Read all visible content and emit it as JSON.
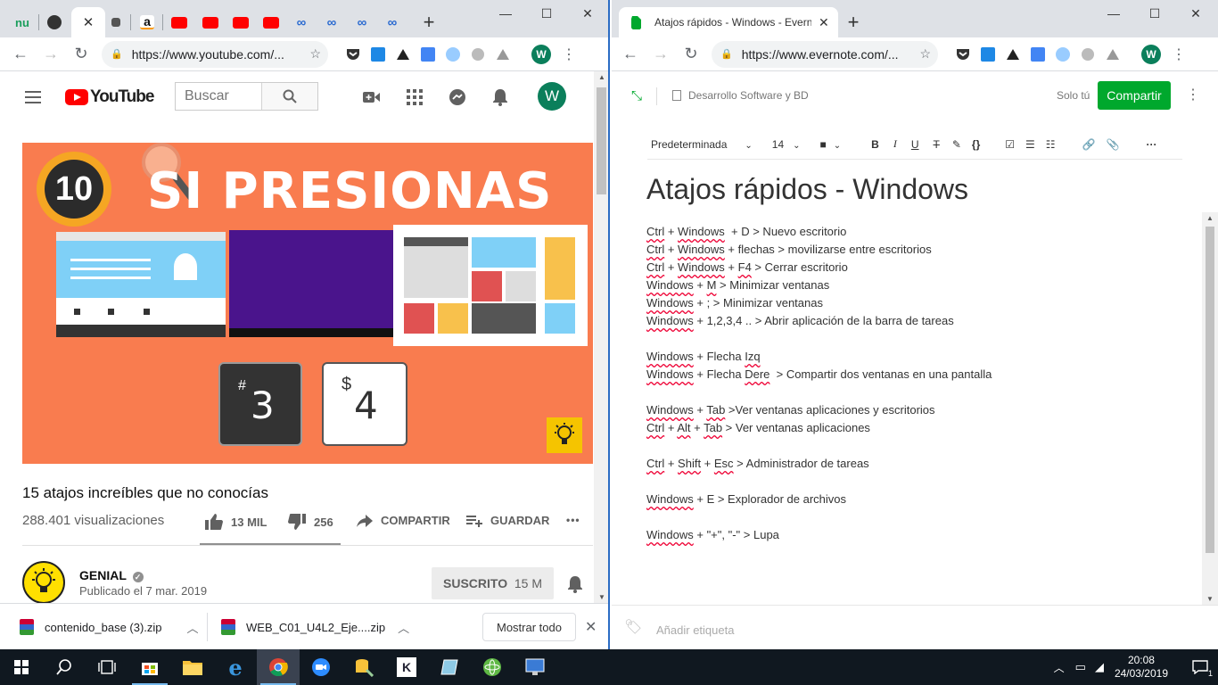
{
  "left_window": {
    "tabs": [
      {
        "icon": "nu-icon",
        "label": "nu"
      },
      {
        "icon": "spider-icon",
        "label": ""
      },
      {
        "icon": "close-icon",
        "label": "✕"
      },
      {
        "icon": "page-icon",
        "label": ""
      },
      {
        "icon": "amazon-icon",
        "label": "a"
      },
      {
        "icon": "youtube-icon",
        "label": ""
      },
      {
        "icon": "youtube-icon",
        "label": ""
      },
      {
        "icon": "youtube-icon",
        "label": ""
      },
      {
        "icon": "youtube-icon",
        "label": ""
      },
      {
        "icon": "link-icon",
        "label": ""
      },
      {
        "icon": "link-icon",
        "label": ""
      },
      {
        "icon": "link-icon",
        "label": ""
      },
      {
        "icon": "link-icon",
        "label": ""
      }
    ],
    "new_tab": "+",
    "url": "https://www.youtube.com/...",
    "profile_initial": "W"
  },
  "youtube": {
    "logo_text": "YouTube",
    "search_placeholder": "Buscar",
    "avatar_initial": "W",
    "thumbnail": {
      "number": "10",
      "headline": "SI PRESIONAS",
      "key1_symbol": "#",
      "key1_char": "3",
      "key2_symbol": "$",
      "key2_char": "4"
    },
    "video_title": "15 atajos increíbles que no conocías",
    "views": "288.401 visualizaciones",
    "likes": "13 MIL",
    "dislikes": "256",
    "share": "COMPARTIR",
    "save": "GUARDAR",
    "more": "•••",
    "channel_name": "GENIAL",
    "published": "Publicado el 7 mar. 2019",
    "subscribe_label": "SUSCRITO",
    "subscribers": "15 M"
  },
  "downloads": {
    "items": [
      {
        "name": "contenido_base (3).zip"
      },
      {
        "name": "WEB_C01_U4L2_Eje....zip"
      }
    ],
    "show_all": "Mostrar todo"
  },
  "right_window": {
    "tab_title": "Atajos rápidos - Windows - Evern",
    "new_tab": "+",
    "url": "https://www.evernote.com/...",
    "profile_initial": "W"
  },
  "evernote": {
    "notebook": "Desarrollo Software y BD",
    "only_you": "Solo tú",
    "share": "Compartir",
    "font_name": "Predeterminada",
    "font_size": "14",
    "title": "Atajos rápidos - Windows",
    "lines": [
      [
        [
          "Ctrl",
          true
        ],
        " + ",
        [
          "Windows",
          true
        ],
        "  + D > Nuevo escritorio"
      ],
      [
        [
          "Ctrl",
          true
        ],
        " + ",
        [
          "Windows",
          true
        ],
        " + flechas > movilizarse entre escritorios"
      ],
      [
        [
          "Ctrl",
          true
        ],
        " + ",
        [
          "Windows",
          true
        ],
        " + ",
        [
          "F4",
          true
        ],
        " > Cerrar escritorio"
      ],
      [
        [
          "Windows",
          true
        ],
        " + ",
        [
          "M",
          true
        ],
        " > Minimizar ventanas"
      ],
      [
        [
          "Windows",
          true
        ],
        " + ; > Minimizar ventanas"
      ],
      [
        [
          "Windows",
          true
        ],
        " + 1,2,3,4 .. > Abrir aplicación de la barra de tareas"
      ],
      [],
      [
        [
          "Windows",
          true
        ],
        " + Flecha ",
        [
          "Izq",
          true
        ]
      ],
      [
        [
          "Windows",
          true
        ],
        " + Flecha ",
        [
          "Dere",
          true
        ],
        "  > Compartir dos ventanas en una pantalla"
      ],
      [],
      [
        [
          "Windows",
          true
        ],
        " + ",
        [
          "Tab",
          true
        ],
        " >Ver ventanas aplicaciones y escritorios"
      ],
      [
        [
          "Ctrl",
          true
        ],
        " + ",
        [
          "Alt",
          true
        ],
        " + ",
        [
          "Tab",
          true
        ],
        " > Ver ventanas aplicaciones"
      ],
      [],
      [
        [
          "Ctrl",
          true
        ],
        " + ",
        [
          "Shift",
          true
        ],
        " + ",
        [
          "Esc",
          true
        ],
        " > Administrador de tareas"
      ],
      [],
      [
        [
          "Windows",
          true
        ],
        " + E > Explorador de archivos"
      ],
      [],
      [
        [
          "Windows",
          true
        ],
        " + \"+\", \"-\" > Lupa"
      ]
    ],
    "add_tag": "Añadir etiqueta"
  },
  "taskbar": {
    "time": "20:08",
    "date": "24/03/2019",
    "notification_count": "1"
  },
  "colors": {
    "youtube_red": "#ff0000",
    "evernote_green": "#00a82d",
    "thumbnail_orange": "#f97c4f",
    "taskbar": "#101820"
  }
}
